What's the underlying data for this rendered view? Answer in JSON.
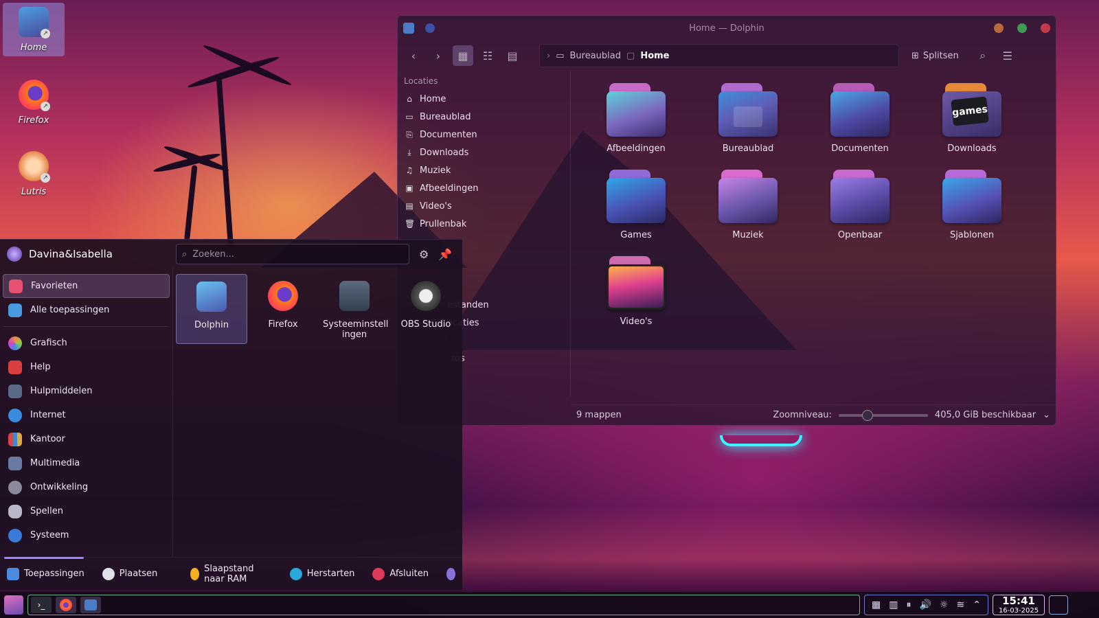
{
  "desktop": {
    "icons": [
      {
        "label": "Home"
      },
      {
        "label": "Firefox"
      },
      {
        "label": "Lutris"
      }
    ]
  },
  "dolphin": {
    "title": "Home — Dolphin",
    "breadcrumb": [
      "Bureaublad",
      "Home"
    ],
    "split_label": "Splitsen",
    "places_header": "Locaties",
    "places": [
      "Home",
      "Bureaublad",
      "Documenten",
      "Downloads",
      "Muziek",
      "Afbeeldingen",
      "Video's",
      "Prullenbak"
    ],
    "partial_sections": [
      "estanden",
      "ocaties",
      "ros"
    ],
    "files": [
      "Afbeeldingen",
      "Bureaublad",
      "Documenten",
      "Downloads",
      "Games",
      "Muziek",
      "Openbaar",
      "Sjablonen",
      "Video's"
    ],
    "downloads_emblem": "games",
    "status": {
      "count": "9 mappen",
      "zoom_label": "Zoomniveau:",
      "zoom_level": 0.3,
      "free_space": "405,0 GiB beschikbaar"
    }
  },
  "launcher": {
    "user": "Davina&Isabella",
    "search_placeholder": "Zoeken...",
    "categories": [
      "Favorieten",
      "Alle toepassingen",
      "Grafisch",
      "Help",
      "Hulpmiddelen",
      "Internet",
      "Kantoor",
      "Multimedia",
      "Ontwikkeling",
      "Spellen",
      "Systeem"
    ],
    "favorites": [
      "Dolphin",
      "Firefox",
      "Systeeminstell ingen",
      "OBS Studio"
    ],
    "footer": {
      "apps_tab": "Toepassingen",
      "places_tab": "Plaatsen",
      "sleep": "Slaapstand naar RAM",
      "restart": "Herstarten",
      "shutdown": "Afsluiten"
    }
  },
  "taskbar": {
    "time": "15:41",
    "date": "16-03-2025"
  }
}
